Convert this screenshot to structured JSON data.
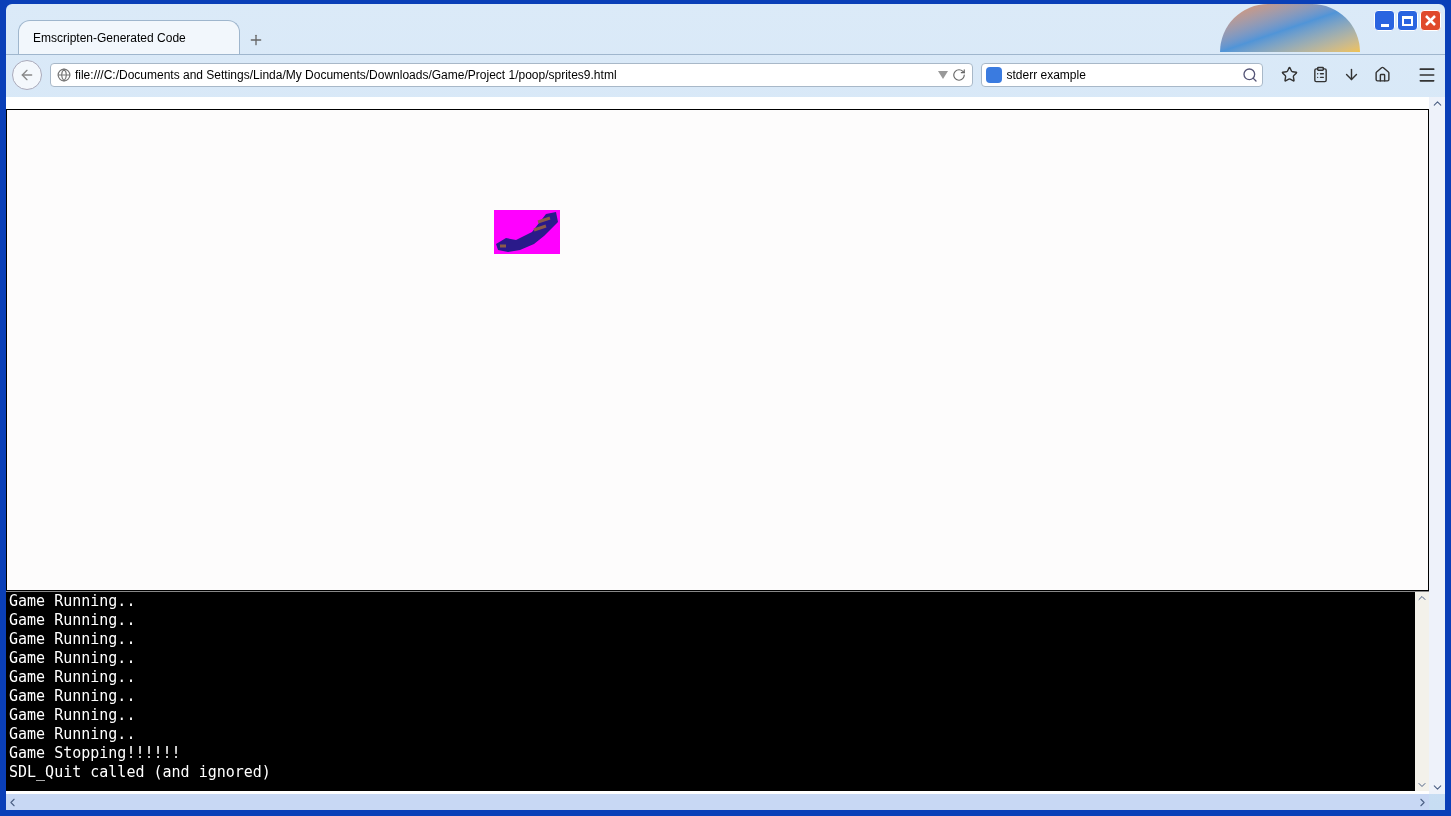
{
  "tabs": [
    {
      "label": "Emscripten-Generated Code",
      "selected": true
    }
  ],
  "address_bar": {
    "value": "file:///C:/Documents and Settings/Linda/My Documents/Downloads/Game/Project 1/poop/sprites9.html"
  },
  "search": {
    "value": "stderr example"
  },
  "console": {
    "lines": [
      "Game Running..",
      "Game Running..",
      "Game Running..",
      "Game Running..",
      "Game Running..",
      "Game Running..",
      "Game Running..",
      "Game Running..",
      "Game Stopping!!!!!!",
      "SDL_Quit called (and ignored)"
    ]
  }
}
